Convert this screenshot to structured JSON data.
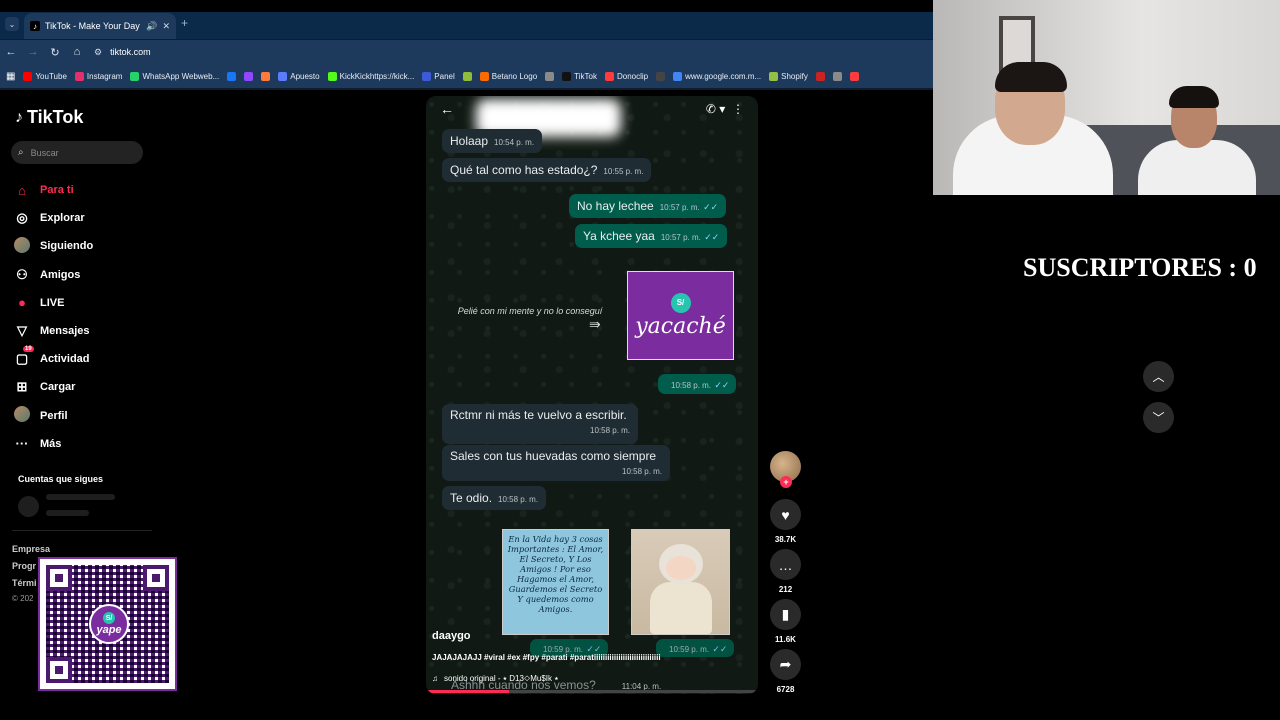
{
  "browser": {
    "tab_title": "TikTok - Make Your Day",
    "url": "tiktok.com",
    "bookmarks": [
      {
        "label": "YouTube",
        "color": "#ff0000"
      },
      {
        "label": "Instagram",
        "color": "#e1306c"
      },
      {
        "label": "WhatsApp Webweb...",
        "color": "#25d366"
      },
      {
        "label": "",
        "color": "#1877f2"
      },
      {
        "label": "",
        "color": "#9146ff"
      },
      {
        "label": "",
        "color": "#ff7a3d"
      },
      {
        "label": "Apuesto",
        "color": "#5b7cff"
      },
      {
        "label": "KickKickhttps://kick...",
        "color": "#53fc18"
      },
      {
        "label": "Panel",
        "color": "#3b5bdb"
      },
      {
        "label": "",
        "color": "#8fbc3a"
      },
      {
        "label": "Betano Logo",
        "color": "#ff6a00"
      },
      {
        "label": "",
        "color": "#8a8a8a"
      },
      {
        "label": "TikTok",
        "color": "#111111"
      },
      {
        "label": "Donoclip",
        "color": "#ff3b3b"
      },
      {
        "label": "",
        "color": "#444444"
      },
      {
        "label": "www.google.com.m...",
        "color": "#4285f4"
      },
      {
        "label": "Shopify",
        "color": "#95bf47"
      },
      {
        "label": "",
        "color": "#cc2222"
      },
      {
        "label": "",
        "color": "#8a8a8a"
      },
      {
        "label": "",
        "color": "#ff3b3b"
      }
    ]
  },
  "sidebar": {
    "logo": "TikTok",
    "search_placeholder": "Buscar",
    "items": [
      {
        "label": "Para ti",
        "icon": "home-icon"
      },
      {
        "label": "Explorar",
        "icon": "compass-icon"
      },
      {
        "label": "Siguiendo",
        "icon": "following-avatar"
      },
      {
        "label": "Amigos",
        "icon": "friends-icon"
      },
      {
        "label": "LIVE",
        "icon": "live-icon"
      },
      {
        "label": "Mensajes",
        "icon": "messages-icon"
      },
      {
        "label": "Actividad",
        "icon": "activity-icon"
      },
      {
        "label": "Cargar",
        "icon": "upload-icon"
      },
      {
        "label": "Perfil",
        "icon": "profile-avatar"
      },
      {
        "label": "Más",
        "icon": "more-icon"
      }
    ],
    "activity_badge": "19",
    "following_title": "Cuentas que sigues",
    "footer": [
      "Empresa",
      "Progr",
      "Térmi",
      "© 202"
    ]
  },
  "qr": {
    "brand": "yape",
    "badge": "S/"
  },
  "video": {
    "chat": {
      "messages": [
        {
          "dir": "in",
          "text": "Holaap",
          "time": "10:54 p. m."
        },
        {
          "dir": "in",
          "text": "Qué tal como has estado¿?",
          "time": "10:55 p. m."
        },
        {
          "dir": "out",
          "text": "No hay lechee",
          "time": "10:57 p. m."
        },
        {
          "dir": "out",
          "text": "Ya kchee yaa",
          "time": "10:57 p. m."
        },
        {
          "dir": "out",
          "text": "",
          "time": "10:58 p. m."
        },
        {
          "dir": "in",
          "text": "Rctmr ni más te vuelvo a escribir.",
          "time": "10:58 p. m."
        },
        {
          "dir": "in",
          "text": "Sales con tus huevadas como siempre",
          "time": "10:58 p. m."
        },
        {
          "dir": "in",
          "text": "Te odio.",
          "time": "10:58 p. m."
        },
        {
          "dir": "out",
          "text": "",
          "time": "10:59 p. m."
        },
        {
          "dir": "out",
          "text": "",
          "time": "10:59 p. m."
        },
        {
          "dir": "in",
          "text": "Ashhh cuando nos vemos?",
          "time": "11:04 p. m."
        }
      ],
      "sticker_caption": "Pelié con mi mente y no lo conseguí",
      "sticker_badge": "S/",
      "sticker_text": "yacaché",
      "image_note": "En la Vida hay 3 cosas Importantes : El Amor, El Secreto, Y Los Amigos ! Por eso Hagamos el Amor, Guardemos el Secreto Y quedemos como Amigos."
    },
    "author": "daaygo",
    "caption": "JAJAJAJAJJ #viral #ex #fpy #parati #paratiiiiiiiiiiiiiiiiiiiiiiiiiiiiii",
    "sound": "sonido original - ⭑ D13◇Mu$Ik ⭑",
    "progress": 0.25
  },
  "actions": {
    "likes": "38.7K",
    "comments": "212",
    "saves": "11.6K",
    "shares": "6728"
  },
  "overlay": {
    "subscribers": "SUSCRIPTORES : 0"
  }
}
